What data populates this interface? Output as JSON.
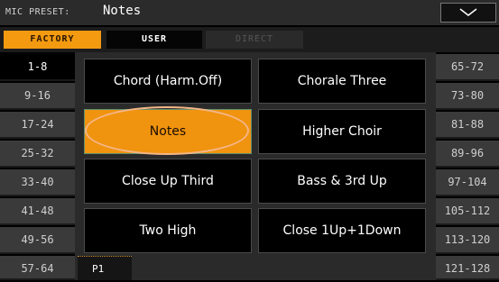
{
  "header": {
    "label": "MIC PRESET:",
    "value": "Notes"
  },
  "tabs": {
    "factory": "FACTORY",
    "user": "USER",
    "direct": "DIRECT"
  },
  "left_pages": [
    "1-8",
    "9-16",
    "17-24",
    "25-32",
    "33-40",
    "41-48",
    "49-56",
    "57-64"
  ],
  "right_pages": [
    "65-72",
    "73-80",
    "81-88",
    "89-96",
    "97-104",
    "105-112",
    "113-120",
    "121-128"
  ],
  "presets": [
    "Chord (Harm.Off)",
    "Chorale Three",
    "Notes",
    "Higher Choir",
    "Close Up Third",
    "Bass & 3rd Up",
    "Two High",
    "Close 1Up+1Down"
  ],
  "selected_preset": "Notes",
  "page_tab": "P1",
  "colors": {
    "accent": "#f39a11",
    "panel": "#2a2a2a",
    "button": "#000000"
  }
}
